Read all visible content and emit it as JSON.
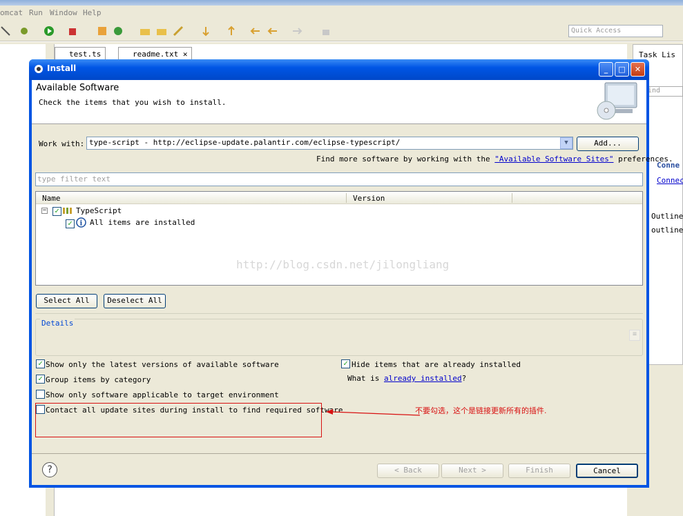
{
  "eclipse": {
    "menu": [
      "omcat",
      "Run",
      "Window",
      "Help"
    ],
    "quick_access_placeholder": "Quick Access",
    "editor_tabs": [
      "test.ts",
      "readme.txt"
    ],
    "right_panel": {
      "title": "Task Lis",
      "find": "ind",
      "connect_title": "Conne",
      "connect_link": "Connec",
      "outline_title": "Outline",
      "outline_text": "outline"
    }
  },
  "dialog": {
    "title": "Install",
    "header_title": "Available Software",
    "header_desc": "Check the items that you wish to install.",
    "work_with_label": "Work with:",
    "work_with_value": "type-script - http://eclipse-update.palantir.com/eclipse-typescript/",
    "add_button": "Add...",
    "find_more_prefix": "Find more software by working with the",
    "find_more_link": "\"Available Software Sites\"",
    "find_more_suffix": "preferences.",
    "filter_placeholder": "type filter text",
    "columns": [
      "Name",
      "Version"
    ],
    "tree": [
      {
        "label": "TypeScript",
        "checked": true
      },
      {
        "label": "All items are installed",
        "checked": true
      }
    ],
    "watermark": "http://blog.csdn.net/jilongliang",
    "select_all": "Select All",
    "deselect_all": "Deselect All",
    "details_label": "Details",
    "options": [
      {
        "label": "Show only the latest versions of available software",
        "checked": true
      },
      {
        "label": "Group items by category",
        "checked": true
      },
      {
        "label": "Show only software applicable to target environment",
        "checked": false
      },
      {
        "label": "Contact all update sites during install to find required software",
        "checked": false
      }
    ],
    "hide_installed": {
      "label": "Hide items that are already installed",
      "checked": true
    },
    "what_is_prefix": "What is",
    "what_is_link": "already installed",
    "what_is_suffix": "?",
    "annotation": "不要勾选，这个是链接更新所有的插件.",
    "buttons": {
      "back": "< Back",
      "next": "Next >",
      "finish": "Finish",
      "cancel": "Cancel"
    }
  },
  "colors": {
    "titlebar": "#0055e5",
    "dialog_bg": "#ece9d8",
    "annotation_red": "#d81010",
    "link": "#0000cc"
  }
}
